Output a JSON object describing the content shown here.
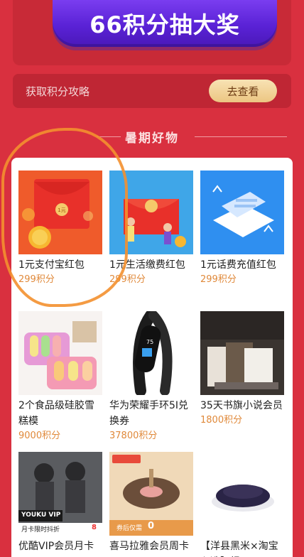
{
  "lottery": {
    "label": "66积分抽大奖"
  },
  "strategy": {
    "label": "获取积分攻略",
    "button": "去查看"
  },
  "section": {
    "title": "暑期好物"
  },
  "products": [
    {
      "title": "1元支付宝红包",
      "points": "299积分",
      "icon": "alipay-red-packet"
    },
    {
      "title": "1元生活缴费红包",
      "points": "299积分",
      "icon": "bill-red-packet"
    },
    {
      "title": "1元话费充值红包",
      "points": "299积分",
      "icon": "phone-recharge"
    },
    {
      "title": "2个食品级硅胶雪糕模",
      "points": "9000积分",
      "icon": "popsicle-mold"
    },
    {
      "title": "华为荣耀手环5I兑换券",
      "points": "37800积分",
      "icon": "smart-band"
    },
    {
      "title": "35天书旗小说会员",
      "points": "1800积分",
      "icon": "books"
    },
    {
      "title": "优酷VIP会员月卡",
      "points": "",
      "icon": "youku-vip",
      "badge_brand": "YOUKU VIP",
      "badge_text": "月卡限时抖折",
      "price": "8"
    },
    {
      "title": "喜马拉雅会员周卡",
      "points": "",
      "icon": "ximalaya",
      "badge_text": "券后仅需",
      "price": "0"
    },
    {
      "title": "【洋县黑米×淘宝心选】绿",
      "points": "",
      "icon": "black-rice"
    }
  ]
}
